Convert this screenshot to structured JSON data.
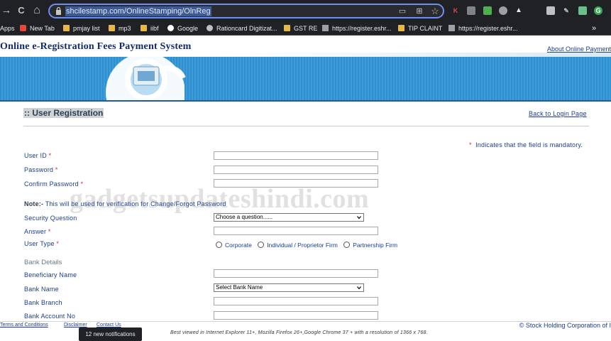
{
  "browser": {
    "url": "shcilestamp.com/OnlineStamping/OlnReg",
    "nav": {
      "back": "→",
      "reload": "C",
      "home": "⌂"
    },
    "bookmarks": [
      {
        "label": "Apps",
        "icon": "apps-icon"
      },
      {
        "label": "New Tab",
        "icon": "newtab-icon"
      },
      {
        "label": "pmjay list",
        "icon": "folder-icon"
      },
      {
        "label": "mp3",
        "icon": "folder-icon"
      },
      {
        "label": "iibf",
        "icon": "folder-icon"
      },
      {
        "label": "Google",
        "icon": "google-icon"
      },
      {
        "label": "Rationcard Digitizat...",
        "icon": "globe-icon"
      },
      {
        "label": "GST RE",
        "icon": "folder-icon"
      },
      {
        "label": "https://register.eshr...",
        "icon": "doc-icon"
      },
      {
        "label": "TIP CLAINT",
        "icon": "folder-icon"
      },
      {
        "label": "https://register.eshr...",
        "icon": "doc-icon"
      }
    ],
    "more": "»"
  },
  "header": {
    "title": "Online e-Registration Fees Payment System",
    "about_link": "About Online Payment"
  },
  "main": {
    "section_title": ":: User Registration",
    "back_link": "Back to Login Page",
    "mandatory_note": "Indicates that the field is mandatory.",
    "mandatory_mark": "*",
    "fields": {
      "user_id": "User ID",
      "password": "Password",
      "confirm_password": "Confirm Password",
      "security_question": "Security Question",
      "answer": "Answer",
      "user_type": "User Type"
    },
    "note_label": "Note:-",
    "note_text": "This will be used for verification for Change/Forgot Password",
    "security_select": "Choose a question......",
    "user_types": [
      "Corporate",
      "Individual / Proprietor Firm",
      "Partnership Firm"
    ],
    "bank_heading": "Bank Details",
    "bank_fields": {
      "beneficiary_name": "Beneficiary Name",
      "bank_name": "Bank Name",
      "bank_branch": "Bank Branch",
      "bank_account_no": "Bank Account No"
    },
    "bank_select": "Select Bank Name",
    "watermark": "gadgetsupdateshindi.com"
  },
  "footer": {
    "terms": "Terms and Conditions",
    "disclaimer": "Disclaimer",
    "contact": "Contact Us",
    "copyright": "© Stock Holding Corporation of I",
    "best_viewed": "Best viewed in Internet Explorer 11+, Mozilla Firefox 26+,Google Chrome 37 + with a resolution of 1366 x 768."
  },
  "notification": {
    "text": "12 new notifications"
  }
}
